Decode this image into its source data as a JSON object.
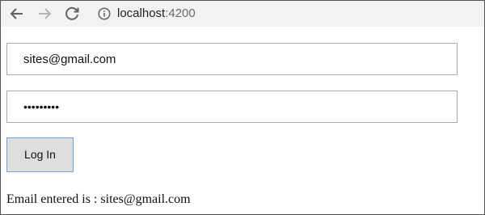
{
  "browser": {
    "url_host": "localhost",
    "url_port": ":4200",
    "back_icon": "arrow-left-icon",
    "forward_icon": "arrow-right-icon",
    "reload_icon": "reload-icon",
    "info_icon": "info-circle-icon"
  },
  "form": {
    "email_value": "sites@gmail.com",
    "password_value": "•••••••••",
    "login_label": "Log In"
  },
  "result": {
    "text": "Email entered is : sites@gmail.com"
  },
  "colors": {
    "toolbar_bg": "#f2f2f2",
    "button_bg": "#dedede",
    "button_focus_border": "#6f9fe6",
    "field_border": "#a9a9a9"
  }
}
